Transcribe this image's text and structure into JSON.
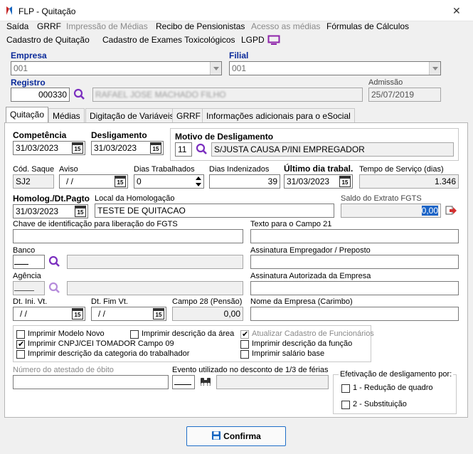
{
  "window": {
    "title": "FLP - Quitação"
  },
  "menu": {
    "row1": [
      "Saída",
      "GRRF",
      "Impressão de Médias",
      "Recibo de Pensionistas",
      "Acesso as médias",
      "Fórmulas de Cálculos"
    ],
    "row2": [
      "Cadastro de Quitação",
      "Cadastro de Exames Toxicológicos",
      "LGPD"
    ]
  },
  "header": {
    "empresa_label": "Empresa",
    "empresa_value": "001",
    "filial_label": "Filial",
    "filial_value": "001",
    "registro_label": "Registro",
    "registro_value": "000330",
    "registro_name": "RAFAEL JOSE MACHADO FILHO",
    "admissao_label": "Admissão",
    "admissao_value": "25/07/2019"
  },
  "tabs": [
    "Quitação",
    "Médias",
    "Digitação de Variáveis",
    "GRRF",
    "Informações adicionais para o eSocial"
  ],
  "form": {
    "competencia_label": "Competência",
    "competencia_value": "31/03/2023",
    "desligamento_label": "Desligamento",
    "desligamento_value": "31/03/2023",
    "motivo_label": "Motivo de Desligamento",
    "motivo_code": "11",
    "motivo_desc": "S/JUSTA CAUSA P/INI EMPREGADOR",
    "cod_saque_label": "Cód. Saque",
    "cod_saque_value": "SJ2",
    "aviso_label": "Aviso",
    "aviso_value": "/ /",
    "dias_trab_label": "Dias Trabalhados",
    "dias_trab_value": "0",
    "dias_indeniz_label": "Dias Indenizados",
    "dias_indeniz_value": "39",
    "ultimo_dia_label": "Último dia trabal.",
    "ultimo_dia_value": "31/03/2023",
    "tempo_servico_label": "Tempo de Serviço (dias)",
    "tempo_servico_value": "1.346",
    "homolog_label": "Homolog./Dt.Pagto",
    "homolog_value": "31/03/2023",
    "local_homolog_label": "Local da Homologação",
    "local_homolog_value": "TESTE DE QUITACAO",
    "saldo_fgts_label": "Saldo do Extrato FGTS",
    "saldo_fgts_value": "0,00",
    "chave_label": "Chave de identificação para liberação do FGTS",
    "chave_value": "",
    "texto21_label": "Texto para o Campo 21",
    "texto21_value": "",
    "banco_label": "Banco",
    "assin_emp_label": "Assinatura Empregador / Preposto",
    "agencia_label": "Agência",
    "assin_aut_label": "Assinatura Autorizada da Empresa",
    "dt_ini_vt_label": "Dt. Ini. Vt.",
    "dt_ini_vt_value": "/ /",
    "dt_fim_vt_label": "Dt. Fim Vt.",
    "dt_fim_vt_value": "/ /",
    "campo28_label": "Campo 28 (Pensão)",
    "campo28_value": "0,00",
    "nome_empresa_label": "Nome da Empresa (Carimbo)",
    "cal_glyph": "15"
  },
  "checkboxes": {
    "modelo_novo": "Imprimir Modelo Novo",
    "cnpj_tomador": "Imprimir CNPJ/CEI TOMADOR Campo 09",
    "desc_categoria": "Imprimir descrição da categoria do trabalhador",
    "desc_area": "Imprimir descrição da área",
    "atualizar_cadastro": "Atualizar Cadastro de Funcionários",
    "desc_funcao": "Imprimir descrição da função",
    "salario_base": "Imprimir salário base"
  },
  "bottom": {
    "atestado_label": "Número do atestado de óbito",
    "evento_label": "Evento utilizado no desconto de 1/3 de férias",
    "efetivacao_label": "Efetivação de desligamento por:",
    "opt1": "1 - Redução de quadro",
    "opt2": "2 - Substituição"
  },
  "buttons": {
    "confirma": "Confirma"
  },
  "colors": {
    "accent": "#0a2a9a",
    "search_icon": "#7b2fbf",
    "button_border": "#1f6fc8"
  }
}
